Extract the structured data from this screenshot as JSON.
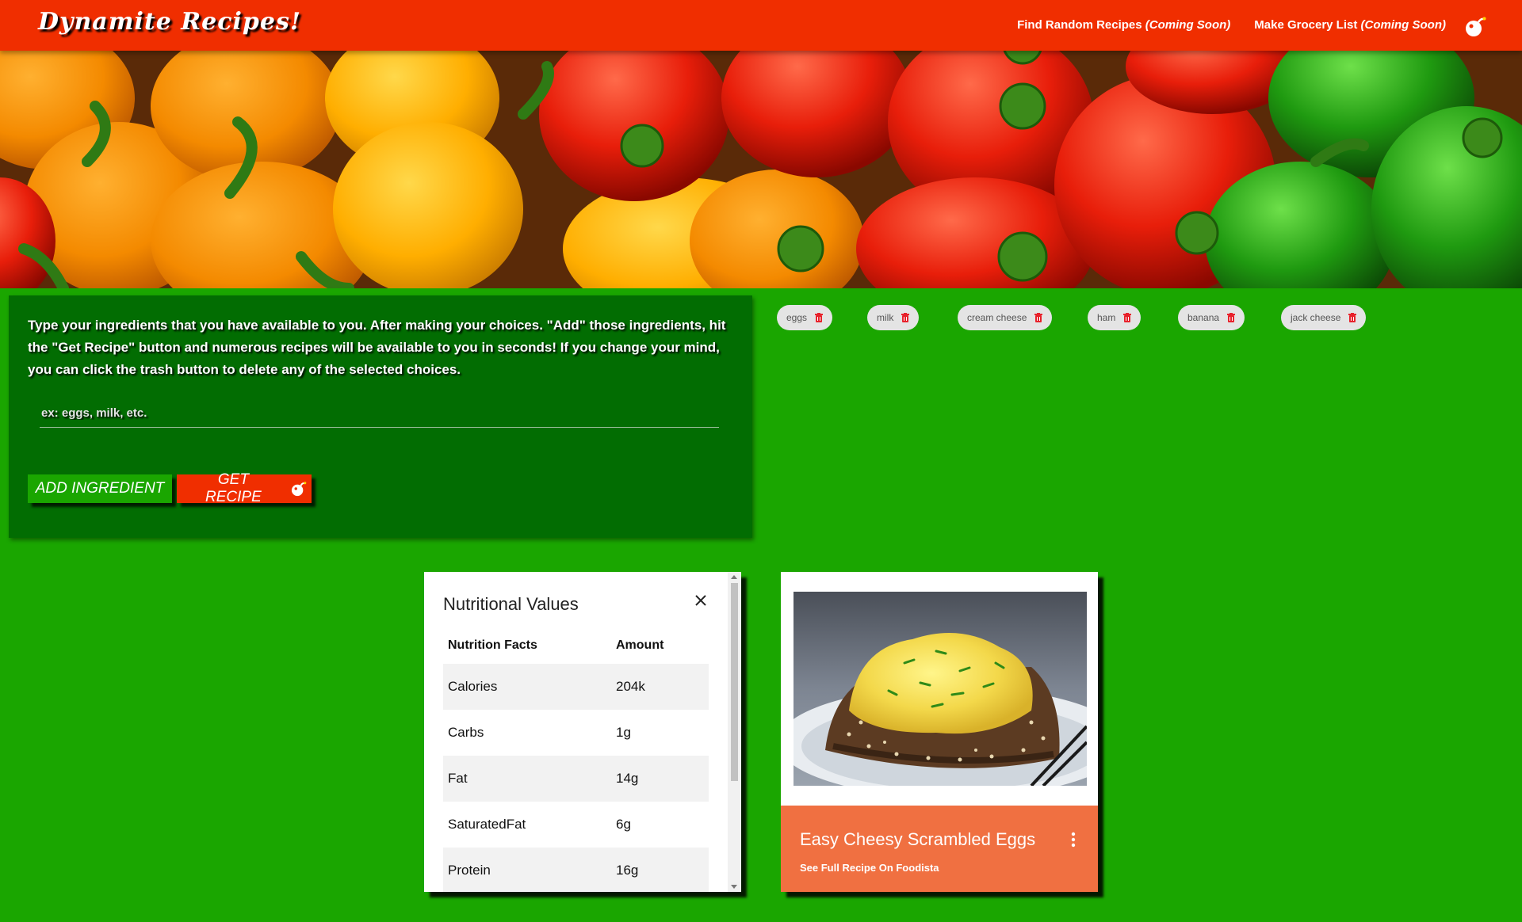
{
  "navbar": {
    "brand": "Dynamite Recipes!",
    "links": [
      {
        "label": "Find Random Recipes",
        "note": "(Coming Soon)"
      },
      {
        "label": "Make Grocery List",
        "note": "(Coming Soon)"
      }
    ],
    "icon": "bomb-icon"
  },
  "hero": {
    "image": "bell-peppers-banner"
  },
  "panel": {
    "instructions": "Type your ingredients that you have available to you. After making your choices. \"Add\" those ingredients, hit the \"Get Recipe\" button and numerous recipes will be available to you in seconds! If you change your mind, you can click the trash button to delete any of the selected choices.",
    "input_placeholder": "ex: eggs, milk, etc.",
    "input_value": "",
    "add_label": "Add Ingredient",
    "get_label": "Get Recipe"
  },
  "chips": [
    "eggs",
    "milk",
    "cream cheese",
    "ham",
    "banana",
    "jack cheese"
  ],
  "nutrition": {
    "title": "Nutritional Values",
    "headers": [
      "Nutrition Facts",
      "Amount"
    ],
    "rows": [
      [
        "Calories",
        "204k"
      ],
      [
        "Carbs",
        "1g"
      ],
      [
        "Fat",
        "14g"
      ],
      [
        "SaturatedFat",
        "6g"
      ],
      [
        "Protein",
        "16g"
      ]
    ]
  },
  "recipe": {
    "title": "Easy Cheesy Scrambled Eggs",
    "link": "See Full Recipe On Foodista",
    "image": "scrambled-eggs-on-toast"
  },
  "colors": {
    "navbar": "#f02e00",
    "background": "#1aa600",
    "panel": "#026d02",
    "card_footer": "#f07041",
    "chip": "#e4e4e4",
    "trash": "#e8212b"
  }
}
